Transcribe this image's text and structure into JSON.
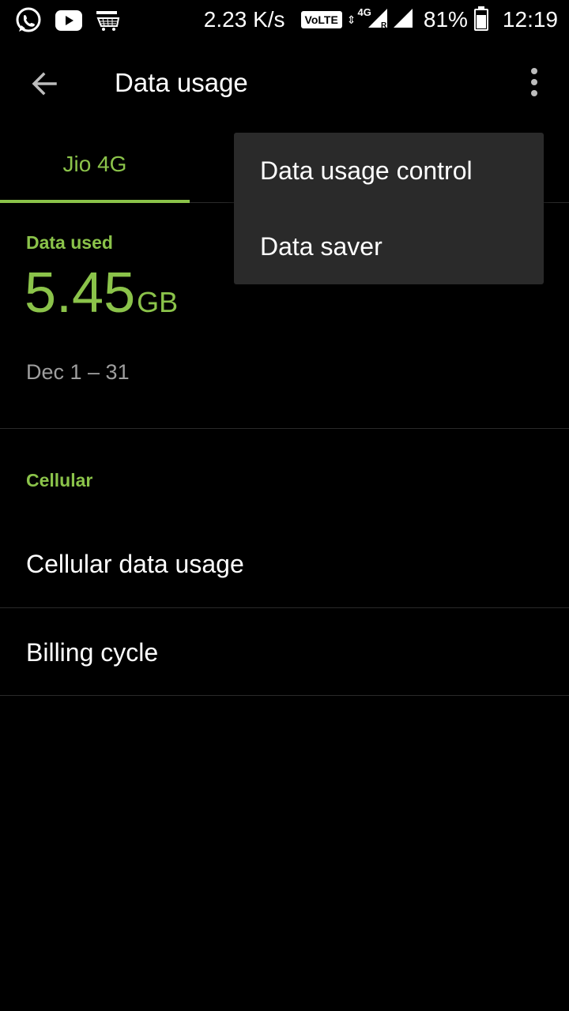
{
  "status_bar": {
    "icons_left": [
      "whatsapp-icon",
      "youtube-icon",
      "amazon-icon"
    ],
    "net_speed": "2.23 K/s",
    "volte": "VoLTE",
    "network": "4G",
    "roaming": "R",
    "battery_percent": "81%",
    "battery_level": 0.81,
    "time": "12:19"
  },
  "toolbar": {
    "back_icon": "arrow-back-icon",
    "title": "Data usage",
    "overflow_icon": "more-vert-icon"
  },
  "tabs": [
    {
      "label": "Jio 4G",
      "selected": true
    }
  ],
  "data_used": {
    "label": "Data used",
    "value": "5.45",
    "unit": "GB",
    "date_range": "Dec 1 – 31"
  },
  "cellular": {
    "header": "Cellular",
    "items": [
      {
        "label": "Cellular data usage"
      },
      {
        "label": "Billing cycle"
      }
    ]
  },
  "menu": {
    "items": [
      {
        "label": "Data usage control"
      },
      {
        "label": "Data saver"
      }
    ]
  },
  "colors": {
    "accent": "#8bc34a",
    "background": "#000000",
    "menu_bg": "#2a2a2a"
  }
}
